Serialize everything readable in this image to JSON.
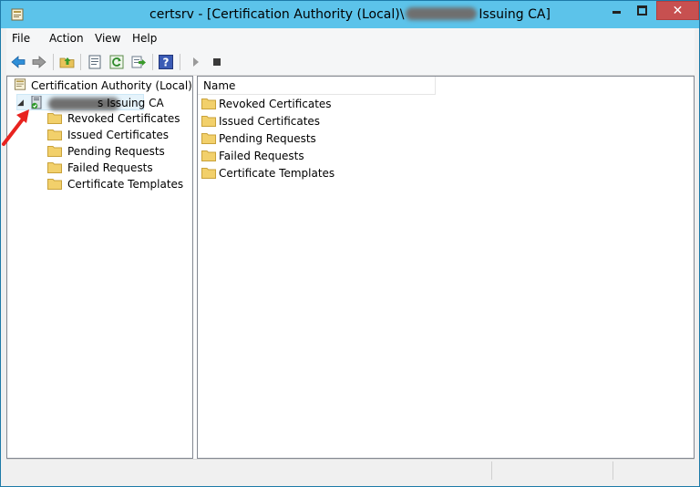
{
  "window": {
    "title_prefix": "certsrv - [Certification Authority (Local)\\",
    "title_suffix": "Issuing CA]"
  },
  "menu": [
    "File",
    "Action",
    "View",
    "Help"
  ],
  "tree": {
    "root": "Certification Authority (Local)",
    "ca_suffix": "s Issuing CA",
    "children": [
      "Revoked Certificates",
      "Issued Certificates",
      "Pending Requests",
      "Failed Requests",
      "Certificate Templates"
    ]
  },
  "list": {
    "column_name": "Name",
    "items": [
      "Revoked Certificates",
      "Issued Certificates",
      "Pending Requests",
      "Failed Requests",
      "Certificate Templates"
    ]
  },
  "colors": {
    "titlebar": "#5cc3ea",
    "close_button": "#c75050",
    "folder": "#f2d06b",
    "arrow": "#e8231f"
  }
}
